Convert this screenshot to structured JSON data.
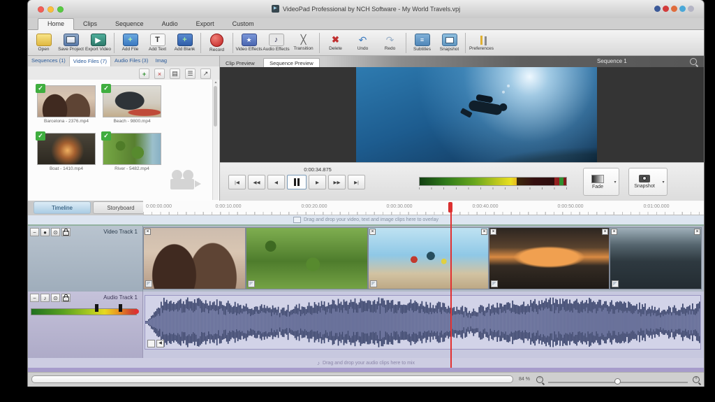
{
  "window": {
    "title": "VideoPad Professional by NCH Software - My World Travels.vpj"
  },
  "ribbon": {
    "tabs": [
      "Home",
      "Clips",
      "Sequence",
      "Audio",
      "Export",
      "Custom"
    ]
  },
  "toolbar": {
    "buttons": [
      "Open",
      "Save Project",
      "Export Video",
      "Add File",
      "Add Text",
      "Add Blank",
      "Record",
      "Video Effects",
      "Audio Effects",
      "Transition",
      "Delete",
      "Undo",
      "Redo",
      "Subtitles",
      "Snapshot",
      "Preferences"
    ]
  },
  "bin": {
    "tabs": [
      "Sequences (1)",
      "Video Files (7)",
      "Audio Files (3)",
      "Imag"
    ],
    "items": [
      {
        "name": "Barcelona - 2376.mp4"
      },
      {
        "name": "Beach - 9800.mp4"
      },
      {
        "name": "Boat - 1410.mp4"
      },
      {
        "name": "River - 5482.mp4"
      }
    ]
  },
  "preview": {
    "tabs": [
      "Clip Preview",
      "Sequence Preview"
    ],
    "sequence_label": "Sequence 1",
    "timecode": "0:00:34.875",
    "fade_label": "Fade",
    "snapshot_label": "Snapshot"
  },
  "timeline": {
    "tabs": [
      "Timeline",
      "Storyboard"
    ],
    "ruler": [
      "0:00:00.000",
      "0:00:10.000",
      "0:00:20.000",
      "0:00:30.000",
      "0:00:40.000",
      "0:00:50.000",
      "0:01:00.000"
    ],
    "overlay_hint": "Drag and drop your video, text and image clips here to overlay",
    "audio_hint": "Drag and drop your audio clips here to mix",
    "video_track_label": "Video Track 1",
    "audio_track_label": "Audio Track 1",
    "zoom_level": "84 %"
  },
  "icons": {
    "record": "●",
    "delete": "✖",
    "undo": "↶",
    "redo": "↷",
    "transition": "╳",
    "music": "♪",
    "star": "★",
    "check": "✓",
    "dropdown": "▾",
    "play": "▶",
    "back": "◀",
    "to_start": "|◀",
    "to_end": "▶|",
    "fast_back": "◀◀",
    "fast_fwd": "▶▶",
    "plus": "+",
    "cross": "×",
    "list": "☰",
    "grid": "▤",
    "arrow": "↗",
    "text": "T",
    "eye": "⊙",
    "minus": "−",
    "lines": "≡",
    "speaker": "♪"
  },
  "colors": {
    "playhead_red": "#e23030",
    "check_green": "#3fae3f",
    "timeline_select_blue": "#aacce4"
  }
}
